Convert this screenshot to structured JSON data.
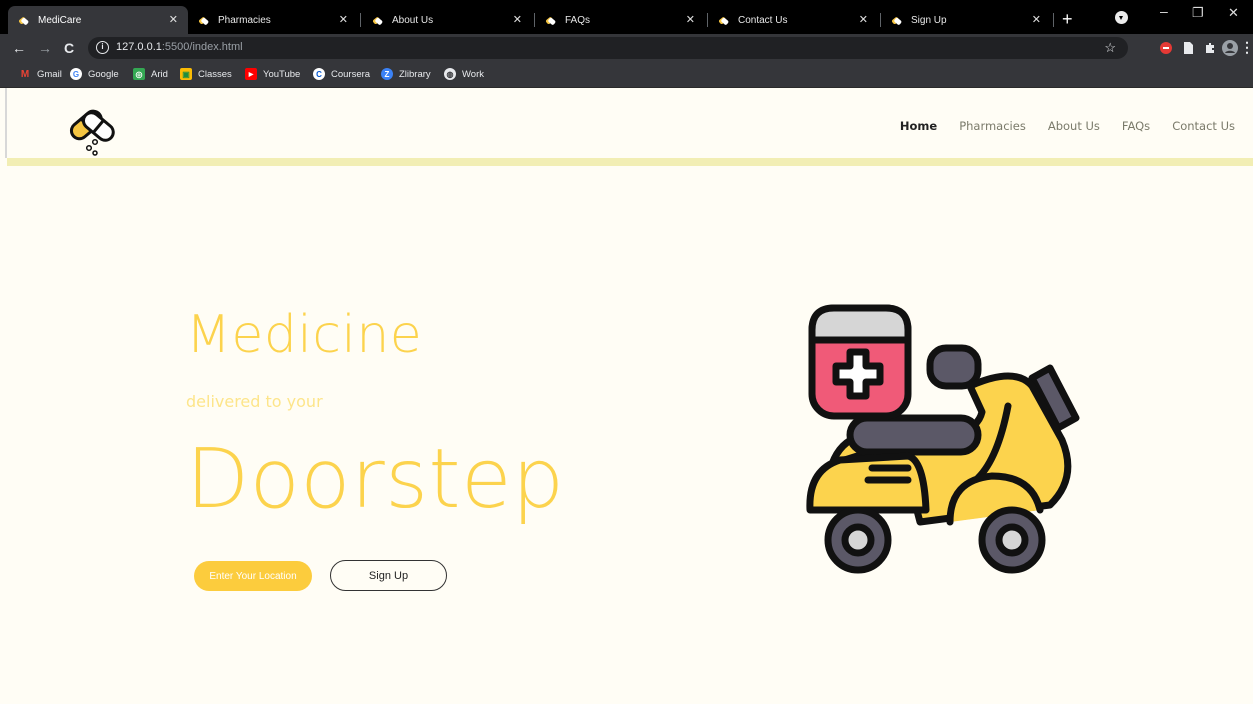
{
  "browser": {
    "tabs": [
      {
        "title": "MediCare",
        "active": true
      },
      {
        "title": "Pharmacies",
        "active": false
      },
      {
        "title": "About Us",
        "active": false
      },
      {
        "title": "FAQs",
        "active": false
      },
      {
        "title": "Contact Us",
        "active": false
      },
      {
        "title": "Sign Up",
        "active": false
      }
    ],
    "new_tab": "+",
    "close_glyph": "✕",
    "url_host": "127.0.0.1",
    "url_rest": ":5500/index.html",
    "bookmarks": [
      {
        "label": "Gmail",
        "icon": "gmail-icon",
        "color": "#ea4335"
      },
      {
        "label": "Google",
        "icon": "google-icon",
        "color": "#4285f4"
      },
      {
        "label": "Arid",
        "icon": "arid-icon",
        "color": "#34a853"
      },
      {
        "label": "Classes",
        "icon": "classroom-icon",
        "color": "#fbbc04"
      },
      {
        "label": "YouTube",
        "icon": "youtube-icon",
        "color": "#ff0000"
      },
      {
        "label": "Coursera",
        "icon": "coursera-icon",
        "color": "#0056d2"
      },
      {
        "label": "Zlibrary",
        "icon": "zlibrary-icon",
        "color": "#3b82f6"
      },
      {
        "label": "Work",
        "icon": "globe-icon",
        "color": "#e8eaed"
      }
    ]
  },
  "site": {
    "nav": [
      "Home",
      "Pharmacies",
      "About Us",
      "FAQs",
      "Contact Us"
    ],
    "hero": {
      "title": "Medicine",
      "subtitle": "delivered to your",
      "big": "Doorstep"
    },
    "buttons": {
      "location": "Enter Your Location",
      "signup": "Sign Up"
    }
  },
  "colors": {
    "accent": "#fcd34d",
    "page_bg": "#fffdf5",
    "header_strip": "#f2eeb4"
  }
}
